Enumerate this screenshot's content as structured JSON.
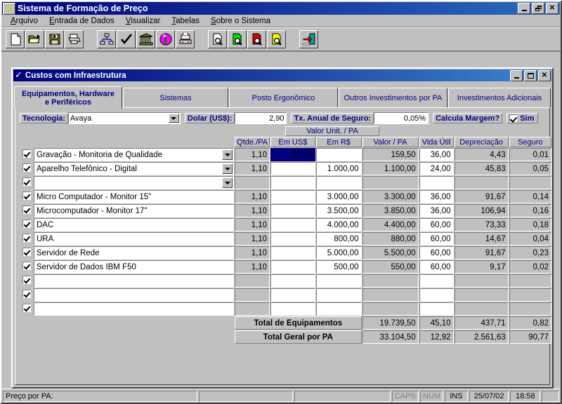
{
  "window": {
    "title": "Sistema de Formação de Preço",
    "icon": "dollar-icon",
    "buttons": {
      "minimize": "minimize-icon",
      "restore": "restore-icon",
      "close": "close-icon"
    }
  },
  "menubar": [
    {
      "label": "Arquivo",
      "accel": "A"
    },
    {
      "label": "Entrada de Dados",
      "accel": "E"
    },
    {
      "label": "Visualizar",
      "accel": "V"
    },
    {
      "label": "Tabelas",
      "accel": "T"
    },
    {
      "label": "Sobre o Sistema",
      "accel": "S"
    }
  ],
  "toolbar": {
    "groups": [
      [
        "new-document-icon",
        "open-folder-icon",
        "save-floppy-icon",
        "print-icon"
      ],
      [
        "org-chart-icon",
        "checkmark-icon",
        "bank-building-icon",
        "info-circle-icon",
        "telephone-icon"
      ],
      [
        "preview-white-icon",
        "preview-green-icon",
        "preview-red-icon",
        "preview-yellow-icon"
      ],
      [
        "exit-door-icon"
      ]
    ]
  },
  "mdi": {
    "title": "Custos com Infraestrutura",
    "icon": "checkmark-icon",
    "buttons": {
      "minimize": "minimize-icon",
      "maximize": "maximize-icon",
      "close": "close-icon"
    }
  },
  "tabs": [
    {
      "label": "Equipamentos, Hardware e Periféricos",
      "line1": "Equipamentos, Hardware",
      "line2": "e Periféricos",
      "active": true
    },
    {
      "label": "Sistemas",
      "active": false
    },
    {
      "label": "Posto Ergonômico",
      "active": false
    },
    {
      "label": "Outros Investimentos por PA",
      "active": false
    },
    {
      "label": "Investimentos Adicionais",
      "active": false
    }
  ],
  "filters": {
    "tecnologia_label": "Tecnologia:",
    "tecnologia_value": "Avaya",
    "dolar_label": "Dolar (US$):",
    "dolar_value": "2,90",
    "seguro_label": "Tx. Anual de Seguro:",
    "seguro_value": "0,05%",
    "margem_label": "Calcula Margem?",
    "margem_checked": true,
    "margem_value": "Sim"
  },
  "grid": {
    "group_header": "Valor Unit. /  PA",
    "headers": {
      "qtde": "Qtde./PA",
      "em_us": "Em US$",
      "em_rs": "Em R$",
      "valor_pa": "Valor / PA",
      "vida_util": "Vida Útil",
      "depreciacao": "Depreciação",
      "seguro": "Seguro"
    },
    "rows": [
      {
        "checked": true,
        "desc": "Gravação - Monitoria de Qualidade",
        "dropdown": true,
        "qtde": "1,10",
        "em_us": "50,00",
        "em_us_selected": true,
        "em_rs": "",
        "valor_pa": "159,50",
        "vida_util": "36,00",
        "depreciacao": "4,43",
        "seguro": "0,01"
      },
      {
        "checked": true,
        "desc": "Aparelho Telefônico - Digital",
        "dropdown": true,
        "qtde": "1,10",
        "em_us": "",
        "em_us_selected": false,
        "em_rs": "1.000,00",
        "valor_pa": "1.100,00",
        "vida_util": "24,00",
        "depreciacao": "45,83",
        "seguro": "0,05"
      },
      {
        "checked": true,
        "desc": "",
        "dropdown": true,
        "qtde": "",
        "em_us": "",
        "em_us_selected": false,
        "em_rs": "",
        "valor_pa": "",
        "vida_util": "",
        "depreciacao": "",
        "seguro": ""
      },
      {
        "checked": true,
        "desc": "Micro Computador - Monitor 15\"",
        "dropdown": false,
        "qtde": "1,10",
        "em_us": "",
        "em_us_selected": false,
        "em_rs": "3.000,00",
        "valor_pa": "3.300,00",
        "vida_util": "36,00",
        "depreciacao": "91,67",
        "seguro": "0,14"
      },
      {
        "checked": true,
        "desc": "Microcomputador - Monitor 17\"",
        "dropdown": false,
        "qtde": "1,10",
        "em_us": "",
        "em_us_selected": false,
        "em_rs": "3.500,00",
        "valor_pa": "3.850,00",
        "vida_util": "36,00",
        "depreciacao": "106,94",
        "seguro": "0,16"
      },
      {
        "checked": true,
        "desc": "DAC",
        "dropdown": false,
        "qtde": "1,10",
        "em_us": "",
        "em_us_selected": false,
        "em_rs": "4.000,00",
        "valor_pa": "4.400,00",
        "vida_util": "60,00",
        "depreciacao": "73,33",
        "seguro": "0,18"
      },
      {
        "checked": true,
        "desc": "URA",
        "dropdown": false,
        "qtde": "1,10",
        "em_us": "",
        "em_us_selected": false,
        "em_rs": "800,00",
        "valor_pa": "880,00",
        "vida_util": "60,00",
        "depreciacao": "14,67",
        "seguro": "0,04"
      },
      {
        "checked": true,
        "desc": "Servidor de Rede",
        "dropdown": false,
        "qtde": "1,10",
        "em_us": "",
        "em_us_selected": false,
        "em_rs": "5.000,00",
        "valor_pa": "5.500,00",
        "vida_util": "60,00",
        "depreciacao": "91,67",
        "seguro": "0,23"
      },
      {
        "checked": true,
        "desc": "Servidor de Dados IBM F50",
        "dropdown": false,
        "qtde": "1,10",
        "em_us": "",
        "em_us_selected": false,
        "em_rs": "500,00",
        "valor_pa": "550,00",
        "vida_util": "60,00",
        "depreciacao": "9,17",
        "seguro": "0,02"
      },
      {
        "checked": true,
        "desc": "",
        "dropdown": false,
        "qtde": "",
        "em_us": "",
        "em_us_selected": false,
        "em_rs": "",
        "valor_pa": "",
        "vida_util": "",
        "depreciacao": "",
        "seguro": ""
      },
      {
        "checked": true,
        "desc": "",
        "dropdown": false,
        "qtde": "",
        "em_us": "",
        "em_us_selected": false,
        "em_rs": "",
        "valor_pa": "",
        "vida_util": "",
        "depreciacao": "",
        "seguro": ""
      },
      {
        "checked": true,
        "desc": "",
        "dropdown": false,
        "qtde": "",
        "em_us": "",
        "em_us_selected": false,
        "em_rs": "",
        "valor_pa": "",
        "vida_util": "",
        "depreciacao": "",
        "seguro": ""
      }
    ],
    "totals": [
      {
        "label": "Total de Equipamentos",
        "valor_pa": "19.739,50",
        "vida_util": "45,10",
        "depreciacao": "437,71",
        "seguro": "0,82"
      },
      {
        "label": "Total Geral por PA",
        "valor_pa": "33.104,50",
        "vida_util": "12,92",
        "depreciacao": "2.561,63",
        "seguro": "90,77"
      }
    ]
  },
  "statusbar": {
    "main": "Preço por PA:",
    "panel2": "",
    "panel3": "",
    "caps": "CAPS",
    "num": "NUM",
    "ins": "INS",
    "date": "25/07/02",
    "time": "18:58"
  },
  "colors": {
    "titlebar_start": "#00007a",
    "titlebar_end": "#2c6dbc",
    "face": "#c0c0c0",
    "label_blue": "#000080",
    "selection": "#000080"
  }
}
